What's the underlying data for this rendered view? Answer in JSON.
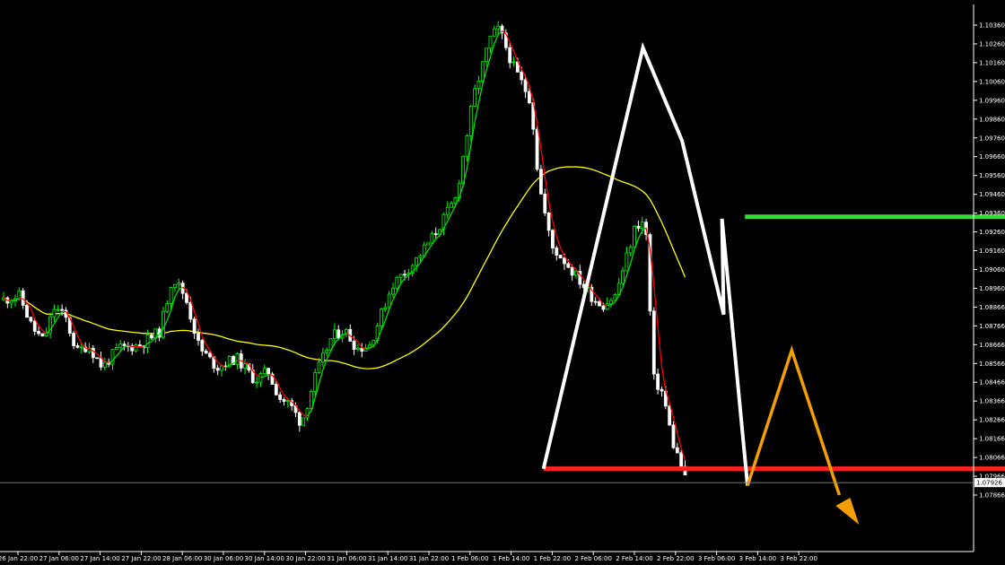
{
  "chart_data": {
    "type": "candlestick",
    "y_ticks": [
      "1.10360",
      "1.10260",
      "1.10160",
      "1.10060",
      "1.09960",
      "1.09860",
      "1.09760",
      "1.09660",
      "1.09560",
      "1.09460",
      "1.09360",
      "1.09260",
      "1.09160",
      "1.09060",
      "1.08960",
      "1.08866",
      "1.08766",
      "1.08666",
      "1.08566",
      "1.08466",
      "1.08366",
      "1.08266",
      "1.08166",
      "1.08066",
      "1.07966",
      "1.07866"
    ],
    "x_ticks": [
      "26 Jan 22:00",
      "27 Jan 06:00",
      "27 Jan 14:00",
      "27 Jan 22:00",
      "28 Jan 06:00",
      "30 Jan 06:00",
      "30 Jan 14:00",
      "30 Jan 22:00",
      "31 Jan 06:00",
      "31 Jan 14:00",
      "31 Jan 22:00",
      "1 Feb 06:00",
      "1 Feb 14:00",
      "1 Feb 22:00",
      "2 Feb 06:00",
      "2 Feb 14:00",
      "2 Feb 22:00",
      "3 Feb 06:00",
      "3 Feb 14:00",
      "3 Feb 22:00"
    ],
    "current_price": "1.07926",
    "grid": false,
    "series_colors": {
      "bull_candle": "#00ff00",
      "bear_candle": "#ffffff",
      "fast_ma": [
        "#00e000",
        "#ff0000"
      ],
      "slow_ma": "#ffff00"
    },
    "pattern_line": {
      "color": "#ffffff",
      "points": [
        [
          31.75,
          1.08
        ],
        [
          37.6,
          1.1024
        ],
        [
          39.9,
          1.09745
        ],
        [
          42.35,
          1.0882
        ],
        [
          42.25,
          1.0933
        ],
        [
          43.75,
          1.0791
        ]
      ]
    },
    "resistance_line": {
      "color": "#33dd33",
      "from_x": 43.6,
      "y": 1.0934
    },
    "support_line": {
      "color": "#ff2020",
      "from_x": 31.75,
      "y": 1.08
    },
    "projection": {
      "color": "#f5a000",
      "points": [
        [
          43.75,
          1.0791
        ],
        [
          46.35,
          1.0863
        ],
        [
          49.15,
          1.0786
        ]
      ]
    }
  }
}
